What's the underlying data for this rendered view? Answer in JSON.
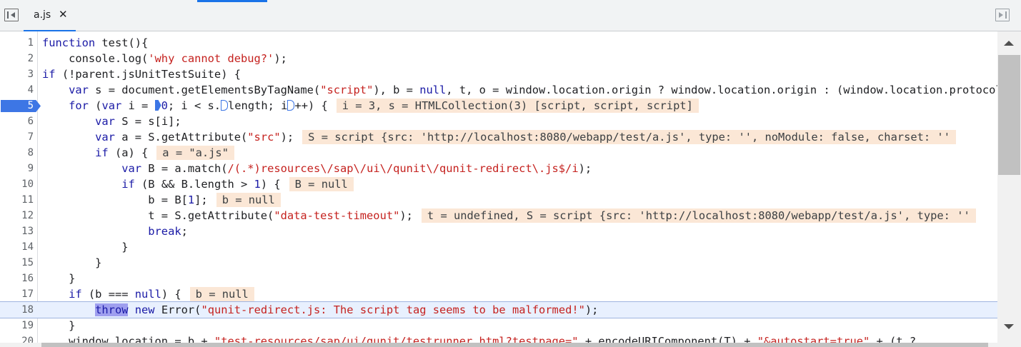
{
  "tab": {
    "filename": "a.js",
    "close_glyph": "✕"
  },
  "lines": [
    {
      "no": "1",
      "html": "<span class=\"kw\">function</span> test(){"
    },
    {
      "no": "2",
      "html": "    console.log(<span class=\"str\">'why cannot debug?'</span>);"
    },
    {
      "no": "3",
      "html": "<span class=\"kw\">if</span> (!parent.jsUnitTestSuite) {"
    },
    {
      "no": "4",
      "html": "    <span class=\"kw\">var</span> s = document.getElementsByTagName(<span class=\"str\">\"script\"</span>), b = <span class=\"nul\">null</span>, t, o = window.location.origin ? window.location.origin : (window.location.protocol"
    },
    {
      "no": "5",
      "breakpoint": true,
      "html": "    <span class=\"kw\">for</span> (<span class=\"kw\">var</span> i = <span class=\"inline-bp\"></span><span class=\"num\">0</span>; i &lt; s.<span class=\"inline-bp hollow\"></span>length; i<span class=\"inline-bp hollow\"></span>++) {<span class=\"hint\">i = 3, s = HTMLCollection(3) [script, script, script]</span>"
    },
    {
      "no": "6",
      "html": "        <span class=\"kw\">var</span> S = s[i];"
    },
    {
      "no": "7",
      "html": "        <span class=\"kw\">var</span> a = S.getAttribute(<span class=\"str\">\"src\"</span>);<span class=\"hint\">S = script {src: 'http://localhost:8080/webapp/test/a.js', type: '', noModule: false, charset: ''</span>"
    },
    {
      "no": "8",
      "html": "        <span class=\"kw\">if</span> (a) {<span class=\"hint\">a = \"a.js\"</span>"
    },
    {
      "no": "9",
      "html": "            <span class=\"kw\">var</span> B = a.match(<span class=\"re\">/(.*)resources\\/sap\\/ui\\/qunit\\/qunit-redirect\\.js$/i</span>);"
    },
    {
      "no": "10",
      "html": "            <span class=\"kw\">if</span> (B &amp;&amp; B.length &gt; <span class=\"num\">1</span>) {<span class=\"hint\">B = null</span>"
    },
    {
      "no": "11",
      "html": "                b = B[<span class=\"num\">1</span>];<span class=\"hint\">b = null</span>"
    },
    {
      "no": "12",
      "html": "                t = S.getAttribute(<span class=\"str\">\"data-test-timeout\"</span>);<span class=\"hint\">t = undefined, S = script {src: 'http://localhost:8080/webapp/test/a.js', type: ''</span>"
    },
    {
      "no": "13",
      "html": "                <span class=\"kw\">break</span>;"
    },
    {
      "no": "14",
      "html": "            }"
    },
    {
      "no": "15",
      "html": "        }"
    },
    {
      "no": "16",
      "html": "    }"
    },
    {
      "no": "17",
      "html": "    <span class=\"kw\">if</span> (b === <span class=\"nul\">null</span>) {<span class=\"hint\">b = null</span>"
    },
    {
      "no": "18",
      "exec": true,
      "html": "        <span class=\"sel\">throw</span> <span class=\"kw\">new</span> Error(<span class=\"str\">\"qunit-redirect.js: The script tag seems to be malformed!\"</span>);"
    },
    {
      "no": "19",
      "html": "    }"
    },
    {
      "no": "20",
      "html": "    window.location = b + <span class=\"str\">\"test-resources/sap/ui/qunit/testrunner.html?testpage=\"</span> + encodeURIComponent(T) + <span class=\"str\">\"&amp;autostart=true\"</span> + (t ? "
    }
  ],
  "colors": {
    "accent": "#1a73e8",
    "breakpoint": "#3d76e5",
    "inline_value_bg": "#fbe7d6",
    "paused_line_bg": "#e8f0fe",
    "keyword": "#1a1aa6",
    "string": "#c5221f"
  }
}
